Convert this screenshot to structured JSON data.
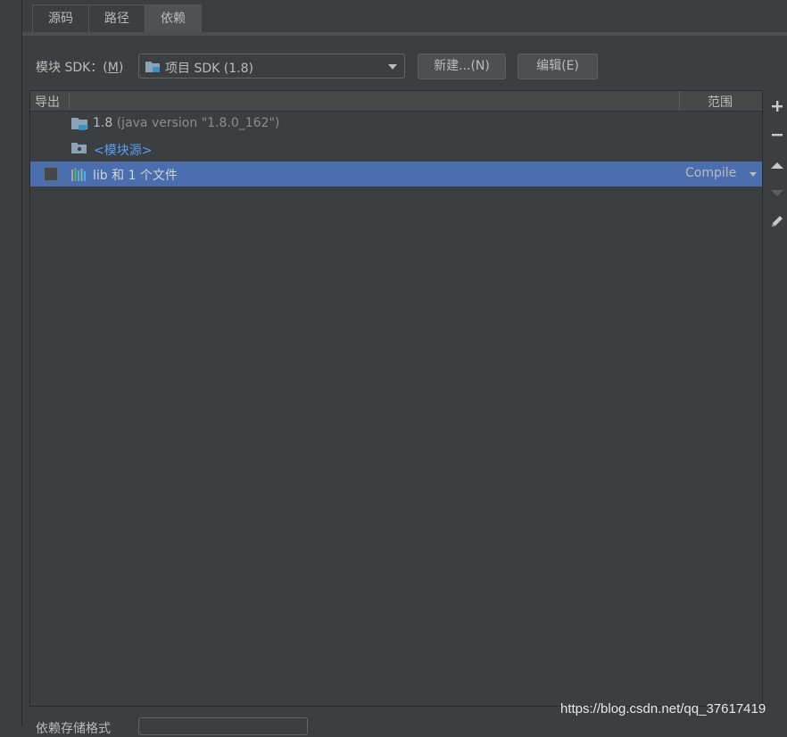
{
  "tabs": [
    {
      "label": "源码"
    },
    {
      "label": "路径"
    },
    {
      "label": "依赖",
      "active": true
    }
  ],
  "sdk": {
    "label": "模块 SDK：(",
    "mnemonic": "M",
    "label_end": ")",
    "selected": "项目 SDK (1.8)",
    "new_button": "新建...(N)",
    "edit_button": "编辑(E)"
  },
  "table": {
    "col_export": "导出",
    "col_scope": "范围",
    "rows": [
      {
        "name": "1.8",
        "detail": "(java version \"1.8.0_162\")"
      },
      {
        "name": "<模块源>"
      },
      {
        "name": "lib 和 1 个文件",
        "scope": "Compile",
        "selected": true,
        "exported": false
      }
    ]
  },
  "toolbar": {
    "add_icon": "plus-icon",
    "remove_icon": "minus-icon",
    "up_icon": "arrow-up-icon",
    "down_icon": "arrow-down-icon",
    "edit_icon": "pencil-icon"
  },
  "bottom": {
    "label": "依赖存储格式"
  },
  "watermark": "https://blog.csdn.net/qq_37617419",
  "colors": {
    "background": "#3c3f41",
    "selection": "#4b6eaf",
    "link": "#589df6",
    "text": "#bbbbbb"
  }
}
